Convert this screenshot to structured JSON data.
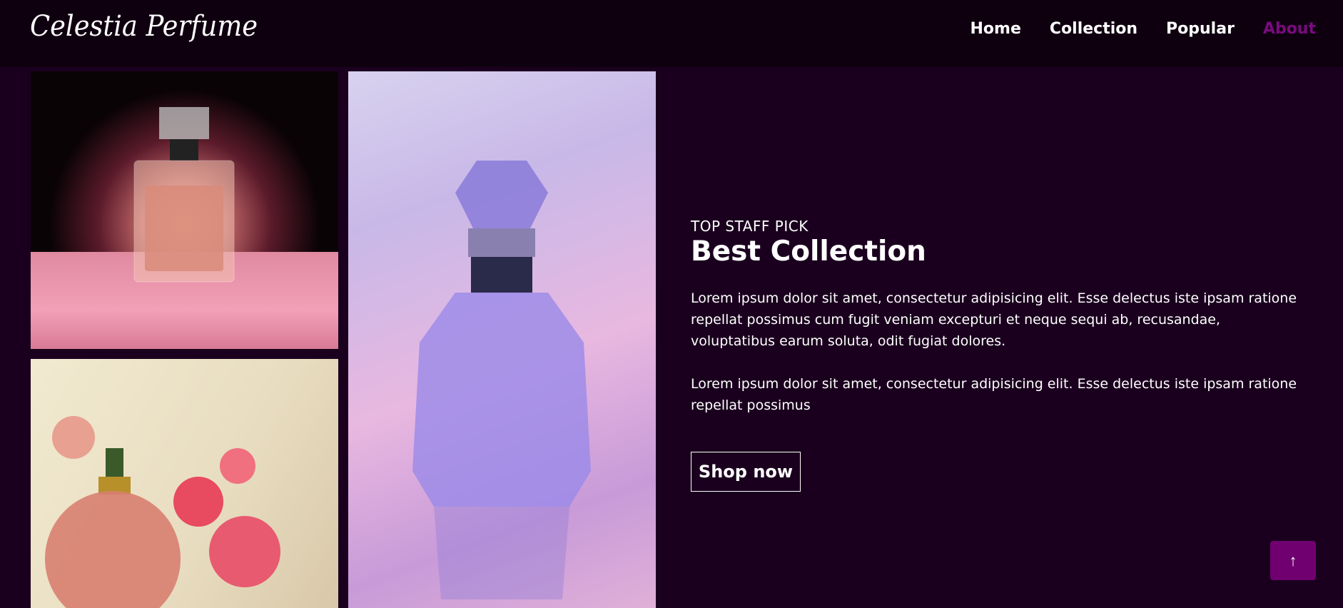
{
  "header": {
    "logo": "Celestia Perfume",
    "nav": [
      {
        "label": "Home",
        "active": false
      },
      {
        "label": "Collection",
        "active": false
      },
      {
        "label": "Popular",
        "active": false
      },
      {
        "label": "About",
        "active": true
      }
    ]
  },
  "gallery": {
    "images": [
      "perfume-bottle-roses",
      "perfume-atomizer-flowers",
      "crystal-perfume-bottle"
    ]
  },
  "feature": {
    "eyebrow": "TOP STAFF PICK",
    "title": "Best Collection",
    "paragraphs": [
      "Lorem ipsum dolor sit amet, consectetur adipisicing elit. Esse delectus iste ipsam ratione repellat possimus cum fugit veniam excepturi et neque sequi ab, recusandae, voluptatibus earum soluta, odit fugiat dolores.",
      "Lorem ipsum dolor sit amet, consectetur adipisicing elit. Esse delectus iste ipsam ratione repellat possimus"
    ],
    "cta": "Shop now"
  },
  "scroll_top": {
    "icon": "arrow-up-icon",
    "glyph": "↑"
  },
  "colors": {
    "background": "#1a001e",
    "header": "#0f0010",
    "accent": "#700070",
    "active_nav": "#7a0a80"
  }
}
